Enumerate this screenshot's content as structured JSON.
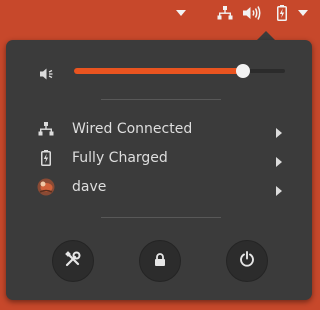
{
  "topbar": {
    "icons": [
      "chevron-down-icon",
      "network-wired-icon",
      "speaker-icon",
      "battery-charged-icon",
      "chevron-down-icon"
    ]
  },
  "volume": {
    "level": 0.8,
    "accent": "#e95420",
    "icon": "speaker-icon"
  },
  "items": [
    {
      "label": "Wired Connected",
      "icon": "network-wired-icon"
    },
    {
      "label": "Fully Charged",
      "icon": "battery-charged-icon"
    },
    {
      "label": "dave",
      "icon": "user-avatar-icon"
    }
  ],
  "buttons": [
    "settings-icon",
    "lock-icon",
    "power-icon"
  ],
  "colors": {
    "panel_bg": "#c7482b",
    "menu_bg": "#3b3b3b"
  }
}
